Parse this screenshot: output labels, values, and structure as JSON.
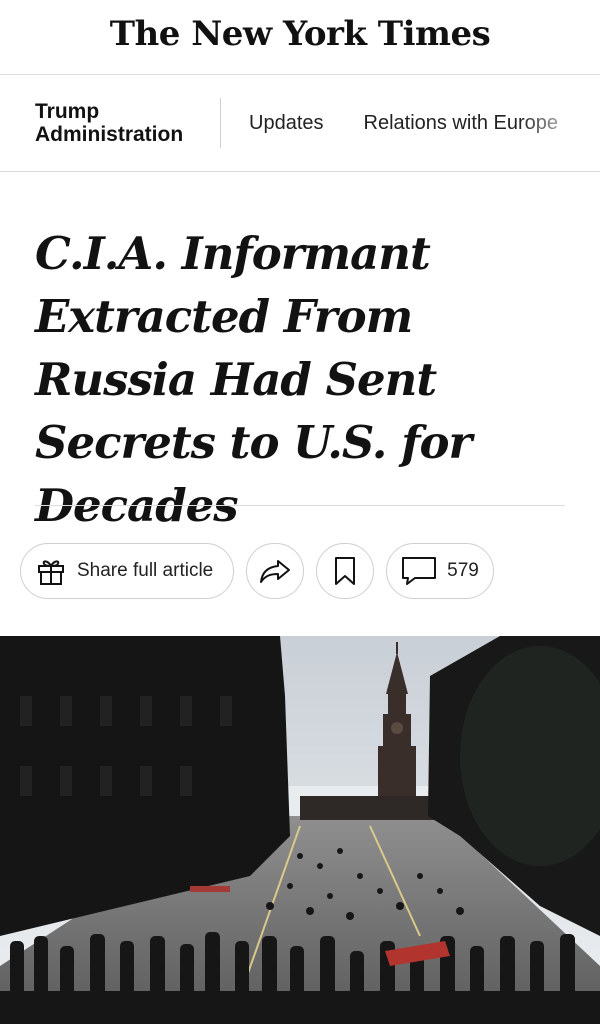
{
  "header": {
    "logo_text": "The New York Times"
  },
  "section_nav": {
    "section_label": "Trump Administration",
    "links": [
      "Updates",
      "Relations with Europe"
    ]
  },
  "article": {
    "headline": "C.I.A. Informant Extracted From Russia Had Sent Secrets to U.S. for Decades"
  },
  "actions": {
    "share_full_label": "Share full article",
    "comment_count": "579"
  },
  "photo": {
    "icons": [
      "gift-icon",
      "share-arrow-icon",
      "bookmark-icon",
      "comment-icon"
    ]
  }
}
